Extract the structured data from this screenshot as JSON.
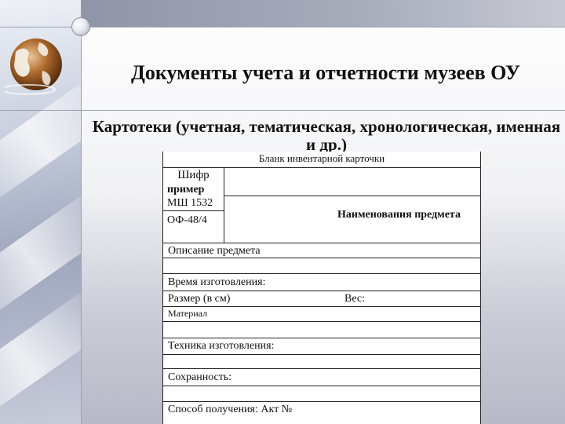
{
  "slide": {
    "title": "Документы учета и отчетности музеев ОУ",
    "subtitle": "Картотеки (учетная, тематическая, хронологическая, именная и др.)"
  },
  "card": {
    "title": "Бланк инвентарной карточки",
    "cipher_label": "Шифр",
    "example_label": "пример",
    "example_code": "МШ 1532",
    "fund_code": "ОФ-48/4",
    "item_name_label": "Наименования предмета",
    "fields": {
      "description": "Описание предмета",
      "time": "Время изготовления:",
      "size": "Размер (в см)",
      "weight": "Вес:",
      "material": "Материал",
      "technique": "Техника изготовления:",
      "condition": "Сохранность:",
      "acquisition": "Способ получения: Акт №"
    }
  },
  "colors": {
    "ink": "#111111",
    "band": "#a9aebd",
    "globe": "#8a4f1c"
  }
}
